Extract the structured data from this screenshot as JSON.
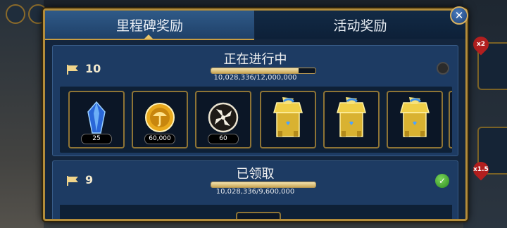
{
  "tabs": {
    "milestone_label": "里程碑奖励",
    "event_label": "活动奖励",
    "active": "milestone"
  },
  "close_icon": "close-icon",
  "milestones": [
    {
      "level": "10",
      "status": "正在进行中",
      "progress_text": "10,028,336/12,000,000",
      "progress_fraction": 0.836,
      "claimed": false,
      "rewards": [
        {
          "icon": "blue-crystal-icon",
          "qty": "25"
        },
        {
          "icon": "gold-coin-icon",
          "qty": "60,000"
        },
        {
          "icon": "fan-token-icon",
          "qty": "60"
        },
        {
          "icon": "gold-chest-icon",
          "qty": ""
        },
        {
          "icon": "gold-chest-icon",
          "qty": ""
        },
        {
          "icon": "gold-chest-icon",
          "qty": ""
        }
      ]
    },
    {
      "level": "9",
      "status": "已领取",
      "progress_text": "10,028,336/9,600,000",
      "progress_fraction": 1.0,
      "claimed": true
    }
  ],
  "side_badges": [
    "x2",
    "x1.5"
  ],
  "colors": {
    "frame_gold": "#b38c3a",
    "panel_blue": "#1d3b63",
    "check_green": "#3aa52a"
  }
}
